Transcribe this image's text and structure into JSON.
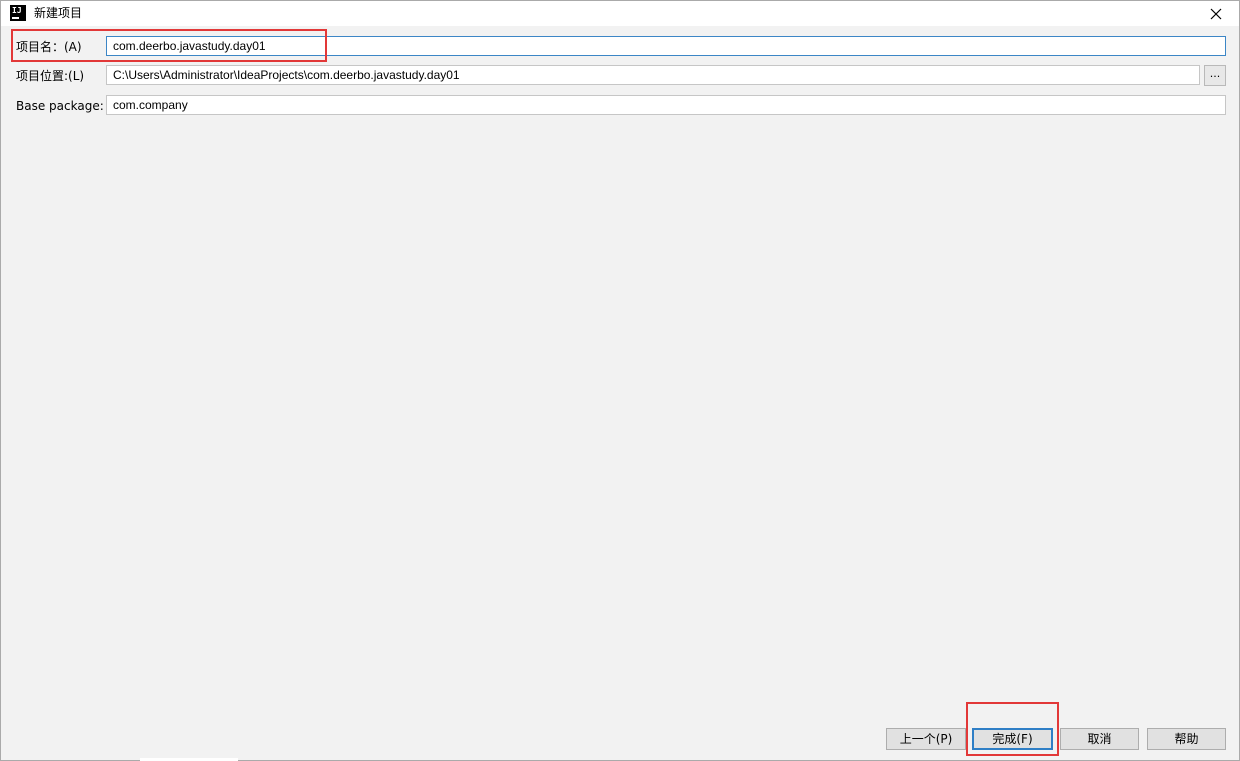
{
  "window": {
    "title": "新建项目",
    "close_symbol": "✕"
  },
  "form": {
    "project_name": {
      "label": "项目名：(A)",
      "value": "com.deerbo.javastudy.day01"
    },
    "project_location": {
      "label": "项目位置:(L)",
      "value": "C:\\Users\\Administrator\\IdeaProjects\\com.deerbo.javastudy.day01",
      "browse_label": "..."
    },
    "base_package": {
      "label": "Base package:",
      "value": "com.company"
    }
  },
  "buttons": {
    "previous": "上一个(P)",
    "finish": "完成(F)",
    "cancel": "取消",
    "help": "帮助"
  },
  "icons": {
    "app": "intellij-idea-icon",
    "close": "close-icon"
  },
  "colors": {
    "highlight": "#e23838",
    "focus_border": "#3c86c6",
    "dialog_background": "#f2f2f2"
  }
}
